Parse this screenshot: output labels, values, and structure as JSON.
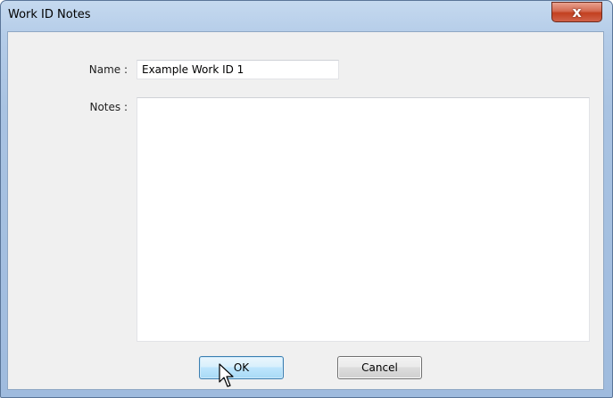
{
  "window": {
    "title": "Work ID Notes",
    "close_glyph": "x",
    "close_icon": "close-icon"
  },
  "form": {
    "name_label": "Name :",
    "name_value": "Example Work ID 1",
    "notes_label": "Notes :",
    "notes_value": ""
  },
  "buttons": {
    "ok_label": "OK",
    "cancel_label": "Cancel"
  },
  "colors": {
    "title_bar": "#b4cce8",
    "close_button": "#c2401f",
    "dialog_bg": "#f0f0f0",
    "ok_button_hover": "#bee6fd"
  },
  "cursor": {
    "icon": "arrow-cursor-icon"
  }
}
